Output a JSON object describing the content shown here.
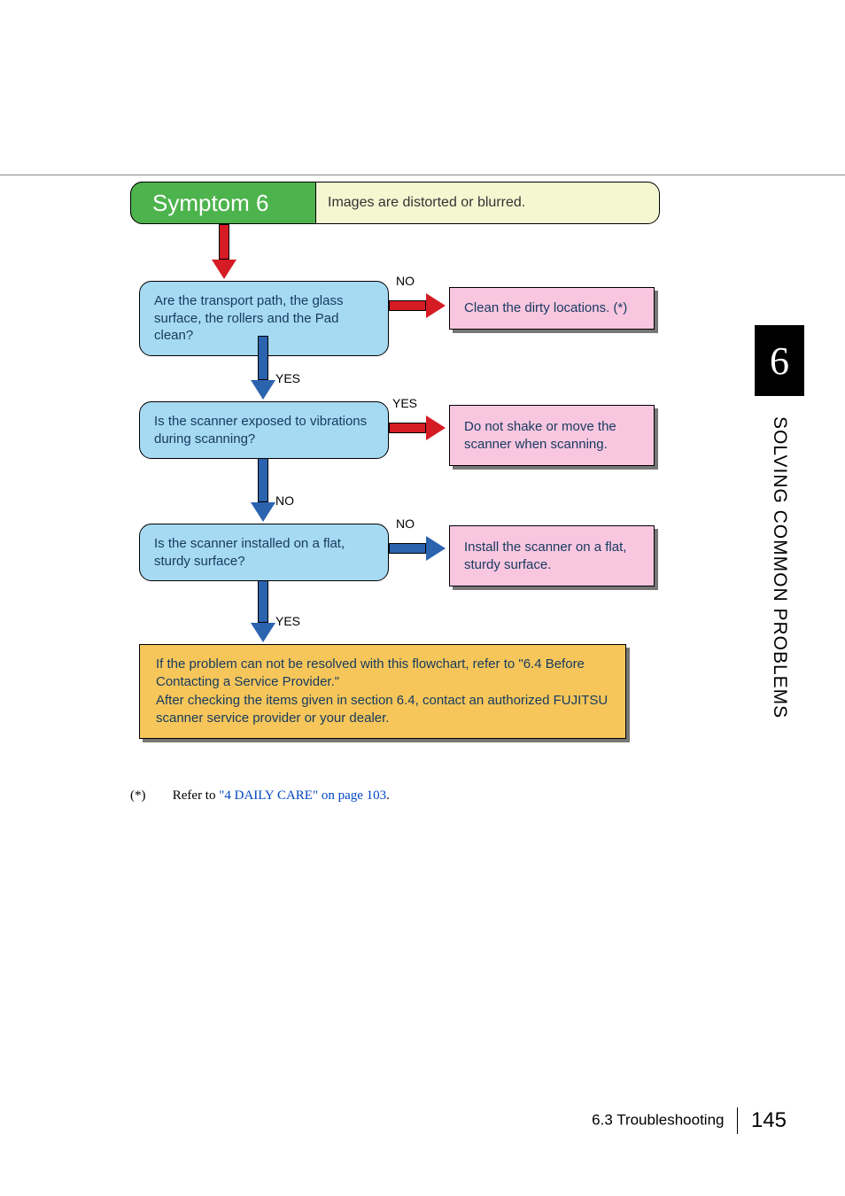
{
  "chart_data": {
    "type": "flowchart",
    "title": "Symptom 6",
    "description": "Images are distorted or blurred.",
    "nodes": [
      {
        "id": "q1",
        "kind": "decision",
        "text": "Are the transport path, the glass surface, the rollers and the Pad clean?"
      },
      {
        "id": "a1",
        "kind": "action",
        "text": "Clean the dirty locations. (*)"
      },
      {
        "id": "q2",
        "kind": "decision",
        "text": "Is the scanner exposed to vibrations during scanning?"
      },
      {
        "id": "a2",
        "kind": "action",
        "text": "Do not shake or move the scanner when scanning."
      },
      {
        "id": "q3",
        "kind": "decision",
        "text": "Is the scanner installed on a flat, sturdy surface?"
      },
      {
        "id": "a3",
        "kind": "action",
        "text": "Install the scanner on a flat, sturdy surface."
      },
      {
        "id": "end",
        "kind": "terminal",
        "text": "If the problem can not be resolved with this flowchart, refer to \"6.4 Before Contacting a Service Provider.\"\nAfter checking the items given in section 6.4, contact an authorized FUJITSU scanner service provider or your dealer."
      }
    ],
    "edges": [
      {
        "from": "title",
        "to": "q1",
        "label": ""
      },
      {
        "from": "q1",
        "to": "a1",
        "label": "NO"
      },
      {
        "from": "q1",
        "to": "q2",
        "label": "YES"
      },
      {
        "from": "q2",
        "to": "a2",
        "label": "YES"
      },
      {
        "from": "q2",
        "to": "q3",
        "label": "NO"
      },
      {
        "from": "q3",
        "to": "a3",
        "label": "NO"
      },
      {
        "from": "q3",
        "to": "end",
        "label": "YES"
      }
    ]
  },
  "header": {
    "symptom_label": "Symptom 6",
    "symptom_desc": "Images are distorted or blurred."
  },
  "q1": "Are the transport path, the glass surface, the rollers and the Pad clean?",
  "a1": "Clean the dirty locations. (*)",
  "q2": "Is the scanner exposed to vibrations during scanning?",
  "a2": "Do not shake or move the scanner when scanning.",
  "q3": "Is the scanner installed on a flat, sturdy surface?",
  "a3": "Install the scanner on a flat, sturdy surface.",
  "final_line1": "If the problem can not be resolved with this flowchart, refer to \"6.4 Before Contacting a Service Provider.\"",
  "final_line2": "After checking the items given in section 6.4, contact an authorized FUJITSU scanner service provider or your dealer.",
  "labels": {
    "no": "NO",
    "yes": "YES"
  },
  "side": {
    "chapter": "6",
    "title": "SOLVING COMMON PROBLEMS"
  },
  "footnote": {
    "marker": "(*)",
    "prefix": "Refer to ",
    "link": "\"4 DAILY CARE\" on page 103",
    "suffix": "."
  },
  "footer": {
    "section": "6.3 Troubleshooting",
    "page": "145"
  }
}
